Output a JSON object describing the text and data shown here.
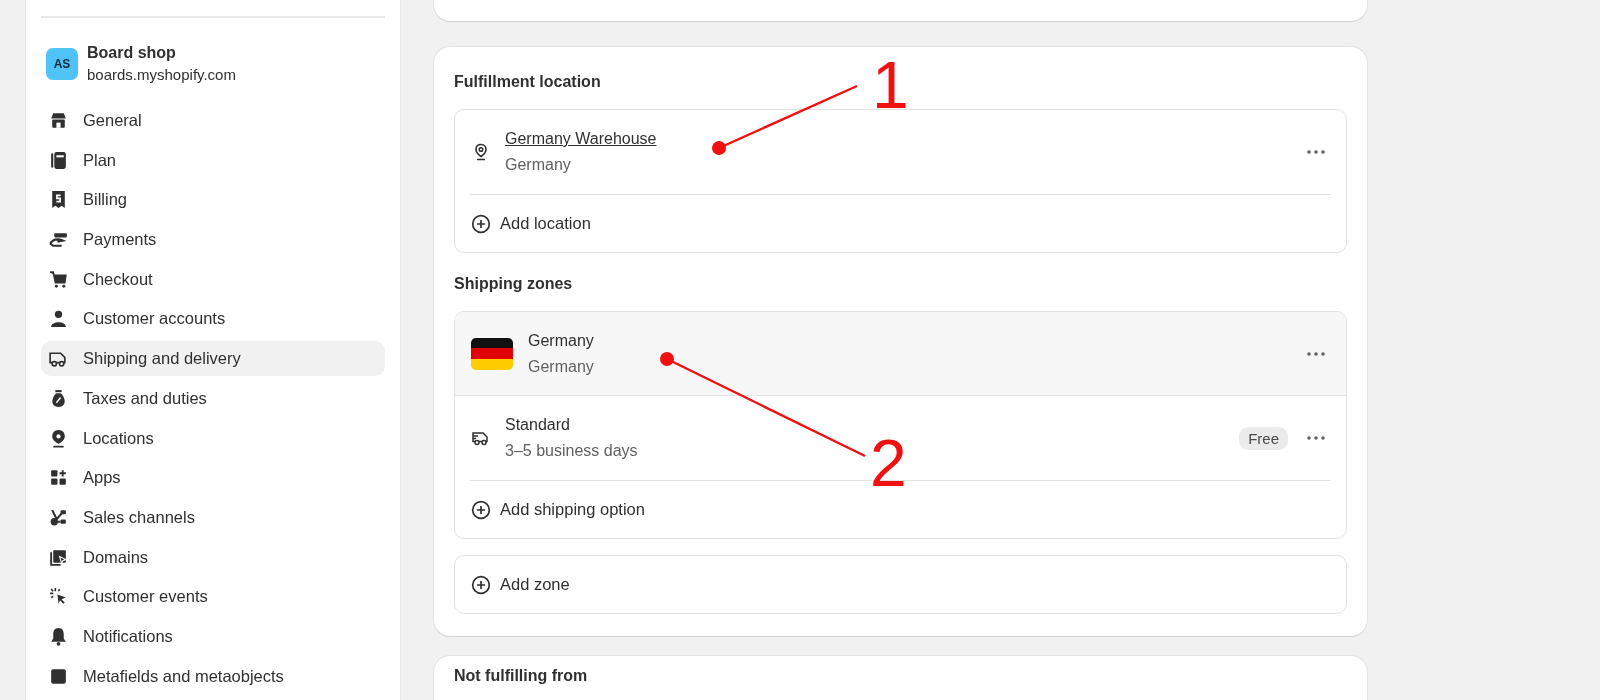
{
  "sidebar": {
    "store": {
      "initials": "AS",
      "name": "Board shop",
      "domain": "boards.myshopify.com"
    },
    "items": [
      {
        "label": "General",
        "selected": false
      },
      {
        "label": "Plan",
        "selected": false
      },
      {
        "label": "Billing",
        "selected": false
      },
      {
        "label": "Payments",
        "selected": false
      },
      {
        "label": "Checkout",
        "selected": false
      },
      {
        "label": "Customer accounts",
        "selected": false
      },
      {
        "label": "Shipping and delivery",
        "selected": true
      },
      {
        "label": "Taxes and duties",
        "selected": false
      },
      {
        "label": "Locations",
        "selected": false
      },
      {
        "label": "Apps",
        "selected": false
      },
      {
        "label": "Sales channels",
        "selected": false
      },
      {
        "label": "Domains",
        "selected": false
      },
      {
        "label": "Customer events",
        "selected": false
      },
      {
        "label": "Notifications",
        "selected": false
      },
      {
        "label": "Metafields and metaobjects",
        "selected": false
      }
    ]
  },
  "fulfillment": {
    "heading": "Fulfillment location",
    "location": {
      "name": "Germany Warehouse",
      "country": "Germany"
    },
    "add_label": "Add location"
  },
  "shipping_zones": {
    "heading": "Shipping zones",
    "zones": [
      {
        "name": "Germany",
        "country": "Germany",
        "rates": [
          {
            "name": "Standard",
            "transit": "3–5 business days",
            "price": "Free"
          }
        ],
        "add_label": "Add shipping option"
      }
    ],
    "add_zone_label": "Add zone"
  },
  "next_section": {
    "heading": "Not fulfilling from"
  },
  "annotations": [
    {
      "label": "1"
    },
    {
      "label": "2"
    }
  ]
}
